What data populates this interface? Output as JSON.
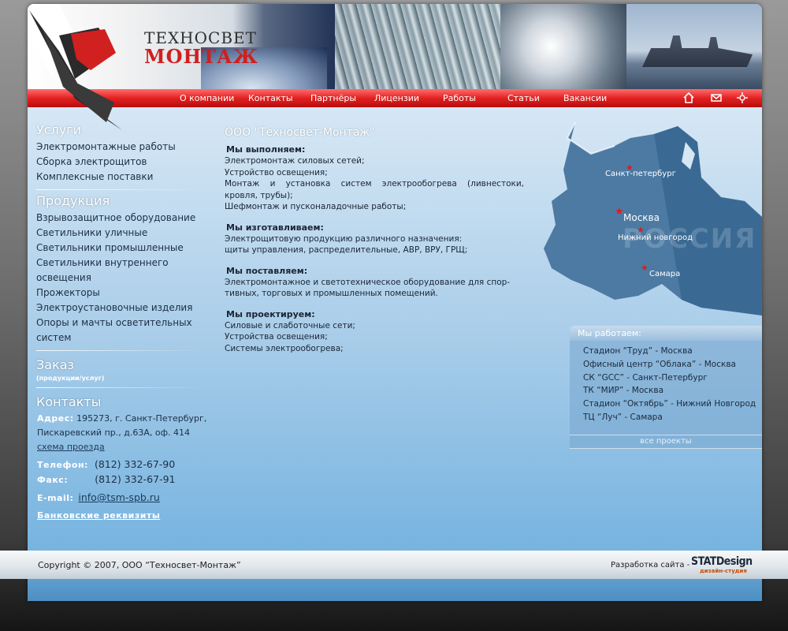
{
  "brand": {
    "line1": "ТЕХНОСВЕТ",
    "line2": "МОНТАЖ"
  },
  "menu": {
    "items": [
      "О компании",
      "Контакты",
      "Партнёры",
      "Лицензии",
      "Работы",
      "Статьи",
      "Вакансии"
    ],
    "icons": [
      "home-icon",
      "mail-icon",
      "sitemap-icon"
    ]
  },
  "sidebar": {
    "services_heading": "Услуги",
    "services": [
      "Электромонтажные работы",
      "Сборка электрощитов",
      "Комплексные поставки"
    ],
    "products_heading": "Продукция",
    "products": [
      "Взрывозащитное оборудование",
      "Светильники уличные",
      "Светильники промышленные",
      "Светильники внутреннего",
      "освещения",
      "Прожекторы",
      "Электроустановочные изделия",
      "Опоры и мачты осветительных",
      "систем"
    ],
    "order_heading": "Заказ",
    "order_sub": "(продукции/услуг)",
    "contacts_heading": "Контакты",
    "address_label": "Адрес:",
    "address_line1": "195273, г. Санкт-Петербург,",
    "address_line2": "Пискаревский пр., д.63А, оф. 414",
    "map_link": "схема проезда",
    "phone_label": "Телефон:",
    "phone": "(812) 332-67-90",
    "fax_label": "Факс:",
    "fax": "(812) 332-67-91",
    "email_label": "E-mail:",
    "email": "info@tsm-spb.ru",
    "bank_link": "Банковские реквизиты"
  },
  "main": {
    "title": "ООО \"Техносвет-Монтаж\"",
    "sections": [
      {
        "heading": "Мы выполняем:",
        "lines": [
          "Электромонтаж силовых сетей;",
          "Устройство освещения;",
          "Монтаж и установка систем электрообогрева (ливнестоки,",
          "кровля, трубы);",
          "Шефмонтаж и пусконаладочные работы;"
        ]
      },
      {
        "heading": "Мы изготавливаем:",
        "lines": [
          "Электрощитовую продукцию различного назначения:",
          "щиты управления, распределительные, АВР, ВРУ, ГРЩ;"
        ]
      },
      {
        "heading": "Мы поставляем:",
        "lines": [
          "Электромонтажное и светотехническое оборудование для спор-",
          "тивных, торговых и промышленных помещений."
        ]
      },
      {
        "heading": "Мы проектируем:",
        "lines": [
          "Силовые и слаботочные сети;",
          "Устройства освещения;",
          "Системы электрообогрева;"
        ]
      }
    ]
  },
  "map": {
    "country": "РОССИЯ",
    "cities": [
      "Санкт-петербург",
      "Москва",
      "Нижний новгород",
      "Самара"
    ]
  },
  "works": {
    "heading": "Мы работаем:",
    "items": [
      "Стадион “Труд” - Москва",
      "Офисный центр “Облака” - Москва",
      "СК “GCC” - Санкт-Петербург",
      "ТК “МИР” - Москва",
      "Стадион “Октябрь” - Нижний Новгород",
      "ТЦ “Луч” - Самара"
    ],
    "all_link": "все проекты"
  },
  "footer": {
    "copyright": "Copyright © 2007, ООО “Техносвет-Монтаж”",
    "dev_label": "Разработка сайта -",
    "studio": "STATDesign",
    "studio_sub": "дизайн-студия"
  },
  "colors": {
    "accent_red": "#e22121",
    "menu_text": "#ffffff",
    "body_text": "#1a2533"
  }
}
